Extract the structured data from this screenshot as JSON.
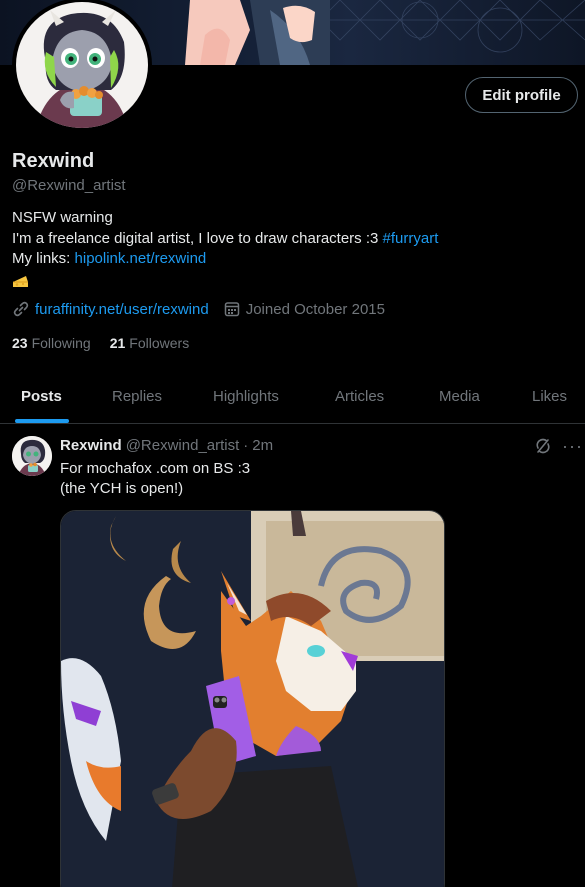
{
  "profile": {
    "name": "Rexwind",
    "handle": "@Rexwind_artist",
    "edit_label": "Edit profile",
    "bio": {
      "line1": "NSFW warning",
      "line2_text": "I'm a freelance digital artist, I love to draw characters :3 ",
      "line2_hashtag": "#furryart",
      "line3_label": "My links: ",
      "line3_link": "hipolink.net/rexwind",
      "emoji": "cheese-emoji"
    },
    "website": "furaffinity.net/user/rexwind",
    "joined": "Joined October 2015",
    "following_count": "23",
    "following_label": "Following",
    "followers_count": "21",
    "followers_label": "Followers"
  },
  "tabs": [
    "Posts",
    "Replies",
    "Highlights",
    "Articles",
    "Media",
    "Likes"
  ],
  "active_tab": "Posts",
  "post": {
    "author": "Rexwind",
    "handle": "@Rexwind_artist",
    "separator": "·",
    "time": "2m",
    "line1": "For mochafox .com on BS :3",
    "line2": "(the YCH is open!)",
    "icons": [
      "grok-icon",
      "more-icon"
    ]
  },
  "colors": {
    "background": "#000000",
    "text": "#e7e9ea",
    "muted": "#71767b",
    "accent": "#1d9bf0",
    "border": "#2f3336"
  },
  "icons": {
    "website": "link-icon",
    "joined": "calendar-icon"
  }
}
